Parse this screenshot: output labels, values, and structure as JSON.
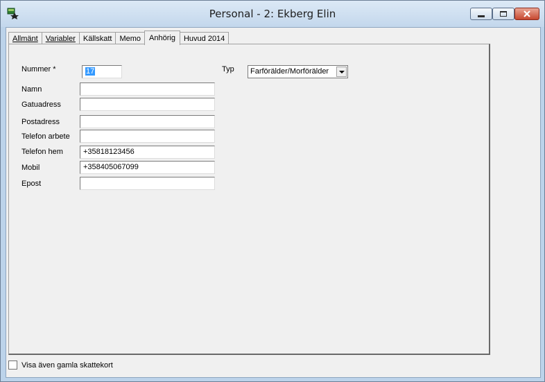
{
  "window": {
    "title": "Personal - 2: Ekberg Elin"
  },
  "tabs": [
    {
      "label": "Allmänt",
      "active": false
    },
    {
      "label": "Variabler",
      "active": false
    },
    {
      "label": "Källskatt",
      "active": false
    },
    {
      "label": "Memo",
      "active": false
    },
    {
      "label": "Anhörig",
      "active": true
    },
    {
      "label": "Huvud 2014",
      "active": false
    }
  ],
  "form": {
    "nummer": {
      "label": "Nummer *",
      "value": "17"
    },
    "typ": {
      "label": "Typ",
      "value": "Farförälder/Morförälder"
    },
    "namn": {
      "label": "Namn",
      "value": ""
    },
    "gatuadress": {
      "label": "Gatuadress",
      "value": ""
    },
    "postadress": {
      "label": "Postadress",
      "value": ""
    },
    "telefon_arbete": {
      "label": "Telefon arbete",
      "value": ""
    },
    "telefon_hem": {
      "label": "Telefon hem",
      "value": "+35818123456"
    },
    "mobil": {
      "label": "Mobil",
      "value": "+358405067099"
    },
    "epost": {
      "label": "Epost",
      "value": ""
    }
  },
  "footer": {
    "checkbox_label": "Visa även gamla skattekort",
    "checked": false
  }
}
